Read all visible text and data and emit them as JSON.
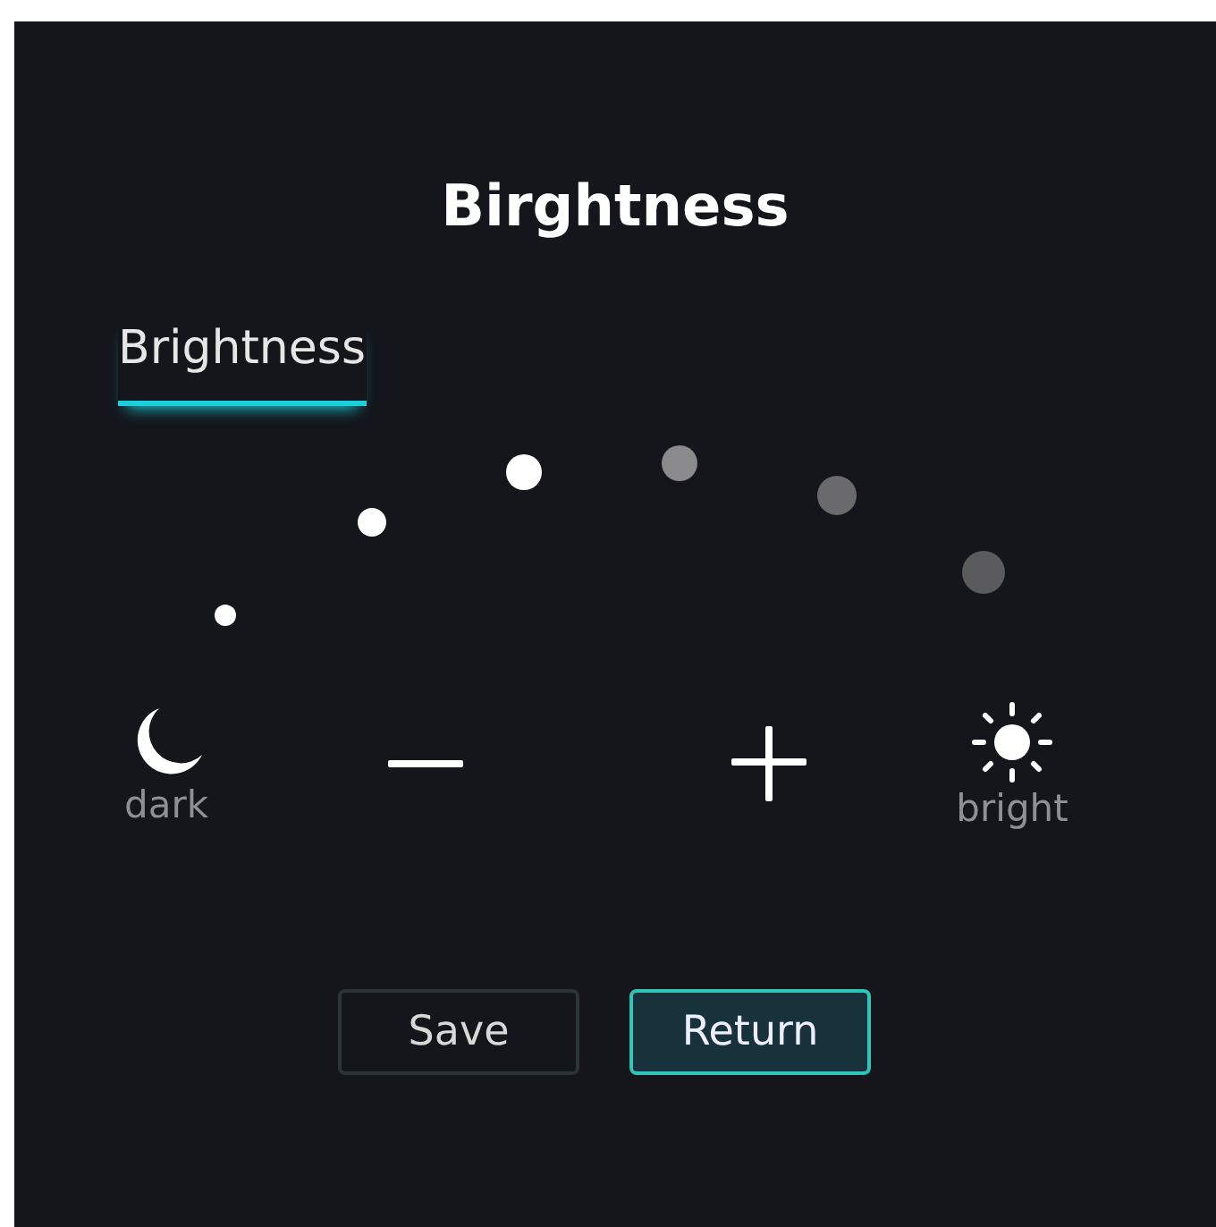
{
  "title": "Birghtness",
  "tabs": [
    {
      "label": "Brightness",
      "selected": true
    }
  ],
  "slider": {
    "level": 0.41
  },
  "controls": {
    "dark_label": "dark",
    "bright_label": "bright"
  },
  "buttons": [
    {
      "label": "Save",
      "selected": false
    },
    {
      "label": "Return",
      "selected": true
    }
  ]
}
